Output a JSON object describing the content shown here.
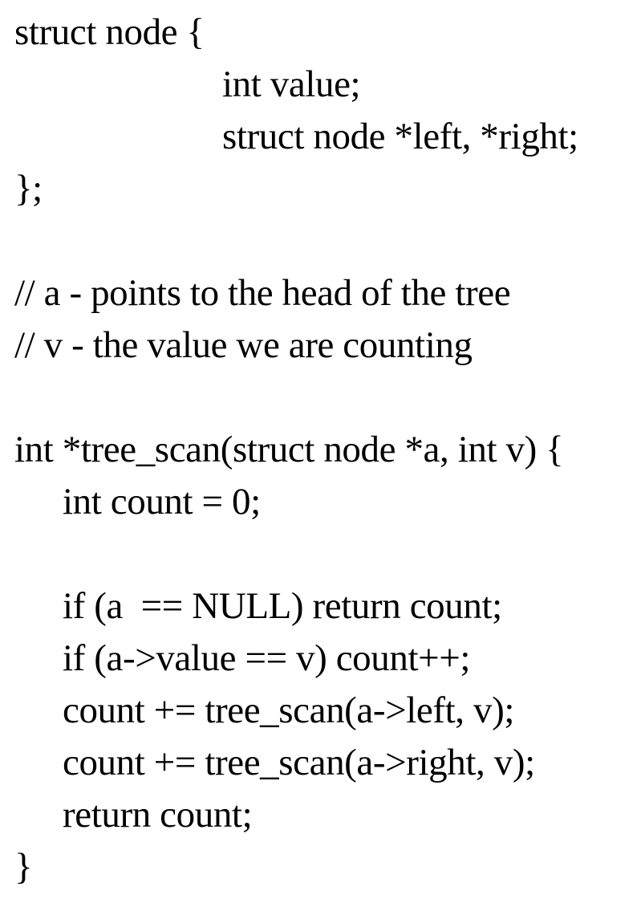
{
  "code_lines": [
    {
      "text": "struct node {"
    },
    {
      "text": "int value;"
    },
    {
      "text": "struct node *left, *right;"
    },
    {
      "text": "};"
    },
    {
      "text": ""
    },
    {
      "text": "// a - points to the head of the tree"
    },
    {
      "text": "// v - the value we are counting"
    },
    {
      "text": ""
    },
    {
      "text": "int *tree_scan(struct node *a, int v) {"
    },
    {
      "text": "int count = 0;"
    },
    {
      "text": ""
    },
    {
      "text": "if (a  == NULL) return count;"
    },
    {
      "text": "if (a->value == v) count++;"
    },
    {
      "text": "count += tree_scan(a->left, v);"
    },
    {
      "text": "count += tree_scan(a->right, v);"
    },
    {
      "text": "return count;"
    },
    {
      "text": "}"
    }
  ]
}
